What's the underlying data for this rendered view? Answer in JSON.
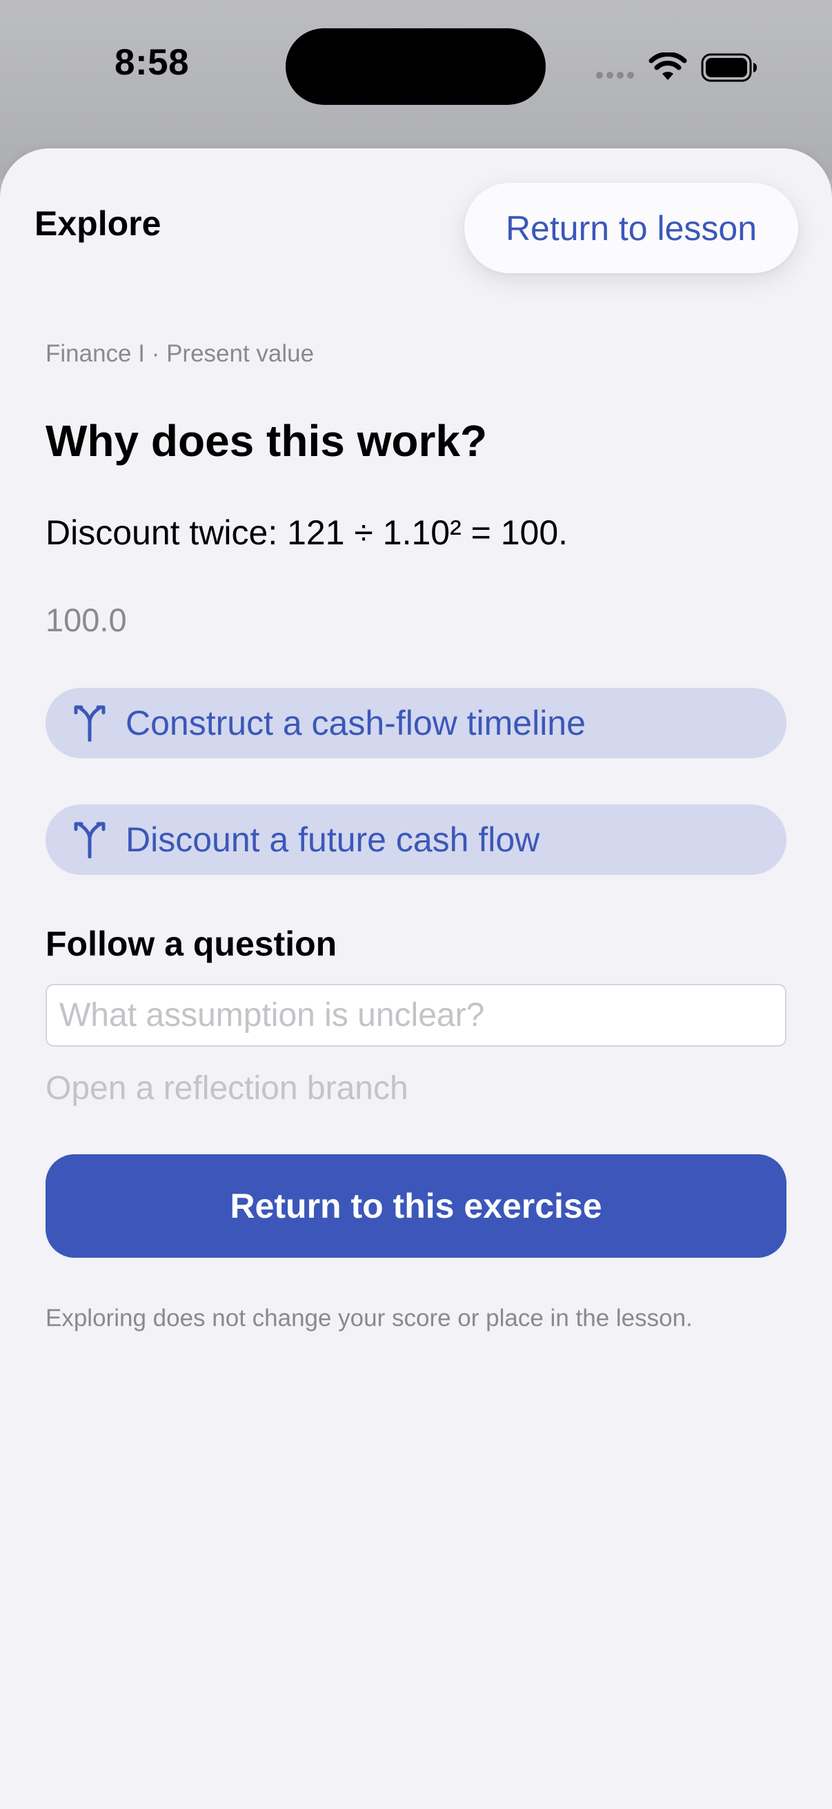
{
  "status_bar": {
    "time": "8:58"
  },
  "sheet": {
    "title": "Explore",
    "return_button": "Return to lesson"
  },
  "content": {
    "breadcrumb": "Finance I · Present value",
    "title": "Why does this work?",
    "explanation": "Discount twice: 121 ÷ 1.10² = 100.",
    "answer_value": "100.0",
    "branches": [
      {
        "label": "Construct a cash-flow timeline",
        "icon": "branch-icon"
      },
      {
        "label": "Discount a future cash flow",
        "icon": "branch-icon"
      }
    ],
    "question_section": {
      "heading": "Follow a question",
      "input_value": "",
      "input_placeholder": "What assumption is unclear?",
      "reflection_link": "Open a reflection branch"
    },
    "primary_button": "Return to this exercise",
    "footnote": "Exploring does not change your score or place in the lesson."
  },
  "colors": {
    "accent": "#3c57b9",
    "chip_background": "#d3d8ee",
    "sheet_background": "#f2f2f7",
    "secondary_text": "#8a8a8e",
    "placeholder_text": "#c3c3c8"
  }
}
